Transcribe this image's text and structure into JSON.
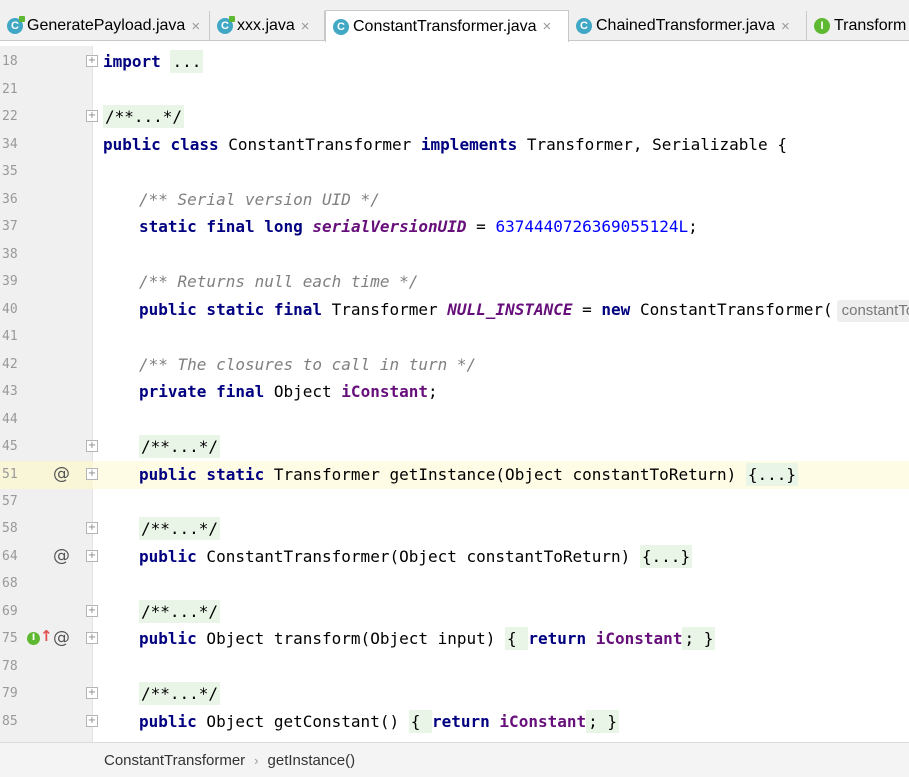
{
  "tabs": [
    {
      "label": "GeneratePayload.java",
      "icon": "class-modified-icon"
    },
    {
      "label": "xxx.java",
      "icon": "class-modified-icon"
    },
    {
      "label": "ConstantTransformer.java",
      "icon": "class-icon",
      "active": true
    },
    {
      "label": "ChainedTransformer.java",
      "icon": "class-icon"
    },
    {
      "label": "Transform",
      "icon": "interface-icon"
    }
  ],
  "icon_letters": {
    "class": "C",
    "interface": "I"
  },
  "close_glyph": "×",
  "fold_glyph": "+",
  "gutter": {
    "override_marker": "@",
    "implements_letter": "I",
    "up_arrow": "↑"
  },
  "lines": {
    "l18": {
      "num": "18",
      "kw": "import",
      "rest": " ",
      "fold": "..."
    },
    "l21": {
      "num": "21"
    },
    "l22": {
      "num": "22",
      "doc": "/**...*/"
    },
    "l34": {
      "num": "34",
      "kw1": "public",
      "kw2": "class",
      "name": " ConstantTransformer ",
      "kw3": "implements",
      "rest": " Transformer, Serializable {"
    },
    "l35": {
      "num": "35"
    },
    "l36": {
      "num": "36",
      "comment": "/** Serial version UID */"
    },
    "l37": {
      "num": "37",
      "kw": "static final long",
      "field": "serialVersionUID",
      "eq": " = ",
      "value": "6374440726369055124L",
      "end": ";"
    },
    "l38": {
      "num": "38"
    },
    "l39": {
      "num": "39",
      "comment": "/** Returns null each time */"
    },
    "l40": {
      "num": "40",
      "kw": "public static final",
      "type": " Transformer ",
      "field": "NULL_INSTANCE",
      "eq": " = ",
      "kw2": "new",
      "rest": " ConstantTransformer(",
      "hint": "constantToRetu"
    },
    "l41": {
      "num": "41"
    },
    "l42": {
      "num": "42",
      "comment": "/** The closures to call in turn */"
    },
    "l43": {
      "num": "43",
      "kw": "private final",
      "type": " Object ",
      "field": "iConstant",
      "end": ";"
    },
    "l44": {
      "num": "44"
    },
    "l45": {
      "num": "45",
      "doc": "/**...*/"
    },
    "l51": {
      "num": "51",
      "kw": "public static",
      "rest": " Transformer getInstance(Object constantToReturn) ",
      "body": "{...}"
    },
    "l57": {
      "num": "57"
    },
    "l58": {
      "num": "58",
      "doc": "/**...*/"
    },
    "l64": {
      "num": "64",
      "kw": "public",
      "rest": " ConstantTransformer(Object constantToReturn) ",
      "body": "{...}"
    },
    "l68": {
      "num": "68"
    },
    "l69": {
      "num": "69",
      "doc": "/**...*/"
    },
    "l75": {
      "num": "75",
      "kw": "public",
      "rest": " Object transform(Object input) ",
      "open": "{ ",
      "kw2": "return",
      "field": "iConstant",
      "close": "; }"
    },
    "l78": {
      "num": "78"
    },
    "l79": {
      "num": "79",
      "doc": "/**...*/"
    },
    "l85": {
      "num": "85",
      "kw": "public",
      "rest": " Object getConstant() ",
      "open": "{ ",
      "kw2": "return",
      "field": "iConstant",
      "close": "; }"
    }
  },
  "breadcrumb": {
    "class_name": "ConstantTransformer",
    "separator": "›",
    "method_name": "getInstance()"
  },
  "colors": {
    "keyword": "#000080",
    "comment": "#808080",
    "number": "#0000ff",
    "field": "#660e7a",
    "current_line": "#fefce4",
    "class_icon": "#40a8c4",
    "interface_icon": "#5fb832"
  }
}
